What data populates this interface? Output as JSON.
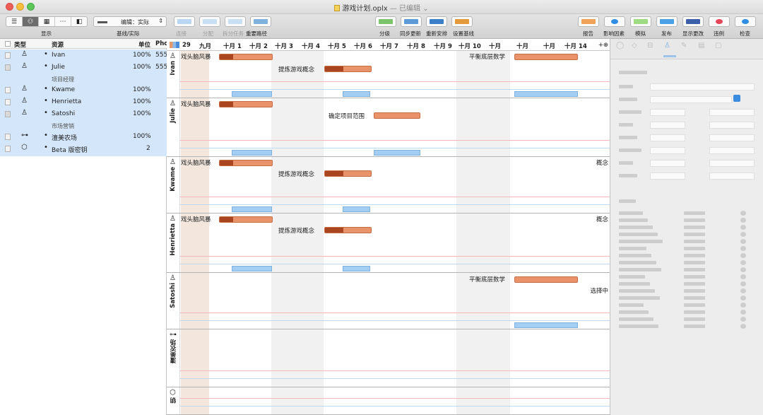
{
  "window": {
    "title": "游戏计划.oplx",
    "edited": "— 已编辑",
    "chevron": "⌄",
    "colors": {
      "selection": "#d4e6f9",
      "task_bar": "#e8936a",
      "task_done": "#a9451f",
      "assignment": "#a3cdf2",
      "accent": "#3b8de0"
    }
  },
  "toolbar": {
    "view_label": "显示",
    "baseline": {
      "value": "编辑：实际",
      "label": "基线/实际"
    },
    "left_labels": [
      "连接",
      "分配",
      "拆分任务",
      "重要路径"
    ],
    "mid_labels": [
      "分级",
      "同步更新",
      "重新安排",
      "设置基线"
    ],
    "right_labels": [
      "报告",
      "影响因素",
      "模拟",
      "发布",
      "显示更改",
      "违例",
      "检查"
    ]
  },
  "resources": {
    "headers": {
      "type": "类型",
      "name": "资源",
      "units": "单位",
      "extra": "Phc"
    },
    "rows": [
      {
        "icon": "person-icon",
        "name": "Ivan",
        "units": "100%",
        "extra": "555",
        "sub": ""
      },
      {
        "icon": "person-icon",
        "name": "Julie",
        "units": "100%",
        "extra": "555",
        "sub": "项目经理"
      },
      {
        "icon": "person-icon",
        "name": "Kwame",
        "units": "100%",
        "extra": "",
        "sub": ""
      },
      {
        "icon": "person-icon",
        "name": "Henrietta",
        "units": "100%",
        "extra": "",
        "sub": ""
      },
      {
        "icon": "person-icon",
        "name": "Satoshi",
        "units": "100%",
        "extra": "",
        "sub": "市场营销"
      },
      {
        "icon": "equipment-icon",
        "name": "澶美农场",
        "units": "100%",
        "extra": "",
        "sub": ""
      },
      {
        "icon": "material-icon",
        "name": "Beta 版密钥",
        "units": "2",
        "extra": "",
        "sub": ""
      }
    ]
  },
  "gantt": {
    "dates": [
      "29",
      "九月",
      "十月 1",
      "十月 2",
      "十月 3",
      "十月 4",
      "十月 5",
      "十月 6",
      "十月 7",
      "十月 8",
      "十月 9",
      "十月 10",
      "十月",
      "十月",
      "十月",
      "十月 14"
    ],
    "add_symbol": "+⊕",
    "lanes": [
      {
        "name": "Ivan",
        "icon": "person-icon",
        "tasks": [
          {
            "label": "戏头脑风暴",
            "done": 0.25
          },
          {
            "label": "提炼游戏概念",
            "done": 0.4
          },
          {
            "label": "平衡底层数学",
            "done": 0
          }
        ]
      },
      {
        "name": "Julie",
        "icon": "person-icon",
        "tasks": [
          {
            "label": "戏头脑风暴",
            "done": 0.25
          },
          {
            "label": "确定项目范围",
            "done": 0
          }
        ]
      },
      {
        "name": "Kwame",
        "icon": "person-icon",
        "tasks": [
          {
            "label": "戏头脑风暴",
            "done": 0.25
          },
          {
            "label": "提炼游戏概念",
            "done": 0.4
          }
        ],
        "edge": "概念"
      },
      {
        "name": "Henrietta",
        "icon": "person-icon",
        "tasks": [
          {
            "label": "戏头脑风暴",
            "done": 0.25
          },
          {
            "label": "提炼游戏概念",
            "done": 0.4
          }
        ],
        "edge": "概念"
      },
      {
        "name": "Satoshi",
        "icon": "person-icon",
        "tasks": [
          {
            "label": "平衡底层数学",
            "done": 0
          }
        ],
        "edge": "选择中"
      },
      {
        "name": "澶美农场",
        "icon": "equipment-icon",
        "tasks": []
      },
      {
        "name": "钥",
        "icon": "material-icon",
        "tasks": []
      }
    ]
  }
}
